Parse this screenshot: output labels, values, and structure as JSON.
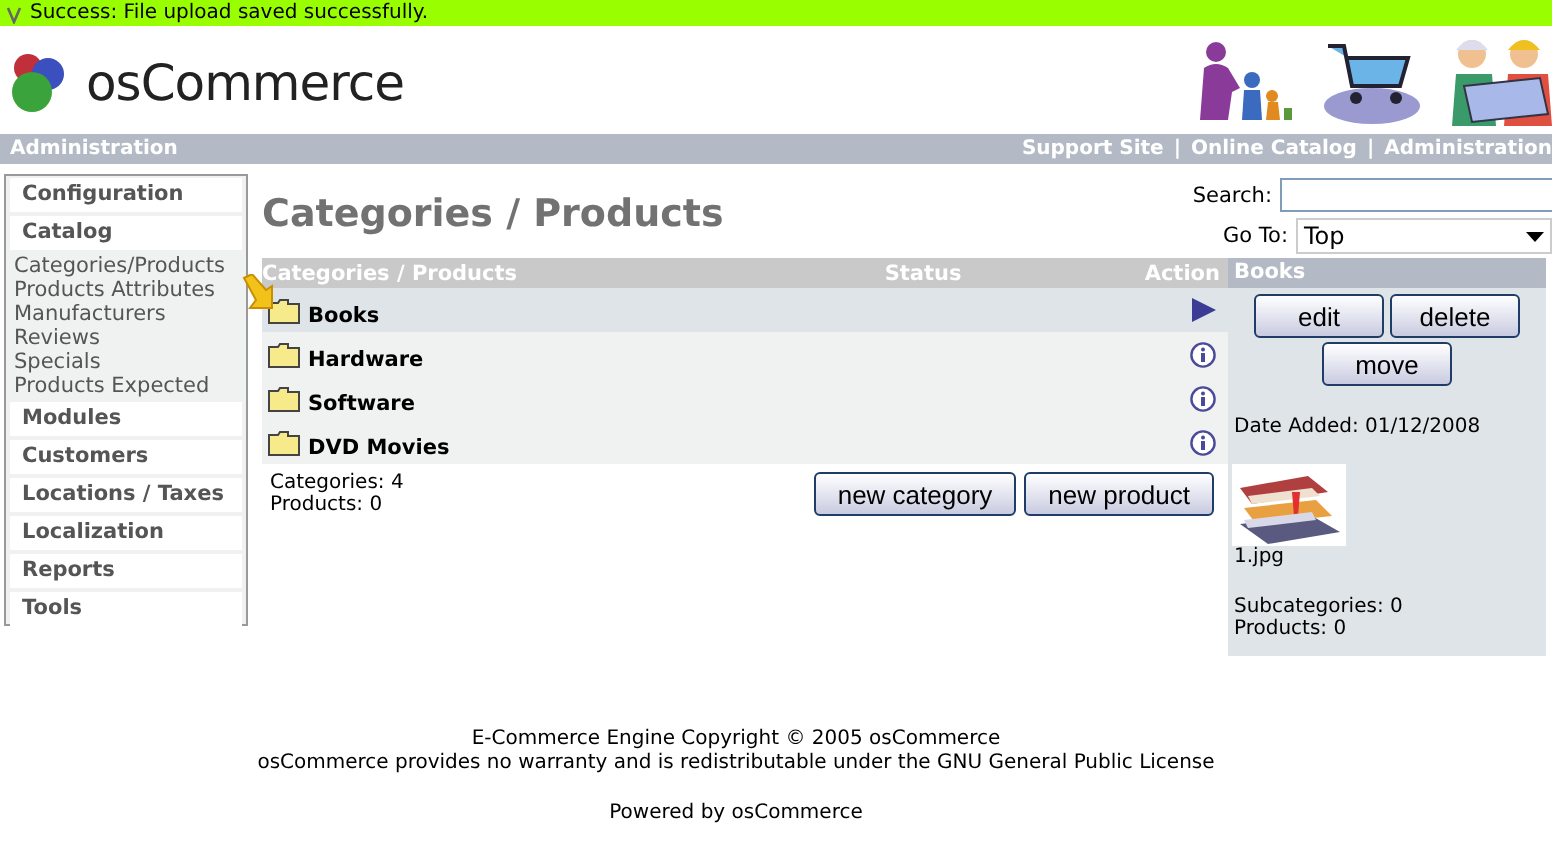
{
  "message": {
    "kind": "success",
    "text": "Success: File upload saved successfully."
  },
  "header": {
    "logo": "osCommerce"
  },
  "nav": {
    "title": "Administration",
    "separator": "|",
    "links": [
      "Support Site",
      "Online Catalog",
      "Administration"
    ]
  },
  "sidebar": [
    {
      "label": "Configuration"
    },
    {
      "label": "Catalog",
      "children": [
        "Categories/Products",
        "Products Attributes",
        "Manufacturers",
        "Reviews",
        "Specials",
        "Products Expected"
      ]
    },
    {
      "label": "Modules"
    },
    {
      "label": "Customers"
    },
    {
      "label": "Locations / Taxes"
    },
    {
      "label": "Localization"
    },
    {
      "label": "Reports"
    },
    {
      "label": "Tools"
    }
  ],
  "page_title": "Categories / Products",
  "search": {
    "label": "Search:"
  },
  "goto": {
    "label": "Go To:",
    "value": "Top"
  },
  "table": {
    "columns": [
      "Categories / Products",
      "Status",
      "Action"
    ],
    "rows": [
      {
        "name": "Books",
        "selected": true
      },
      {
        "name": "Hardware",
        "selected": false
      },
      {
        "name": "Software",
        "selected": false
      },
      {
        "name": "DVD Movies",
        "selected": false
      }
    ]
  },
  "summary": [
    "Categories: 4",
    "Products: 0"
  ],
  "table_buttons": [
    "new category",
    "new product"
  ],
  "panel": {
    "title": "Books",
    "buttons": [
      "edit",
      "delete",
      "move"
    ],
    "date_added": "Date Added: 01/12/2008",
    "image_caption": "1.jpg",
    "info": [
      "Subcategories: 0",
      "Products: 0"
    ]
  },
  "footer": {
    "lines": [
      "E-Commerce Engine Copyright © 2005 osCommerce",
      "osCommerce provides no warranty and is redistributable under the GNU General Public License"
    ],
    "powered": "Powered by osCommerce"
  }
}
